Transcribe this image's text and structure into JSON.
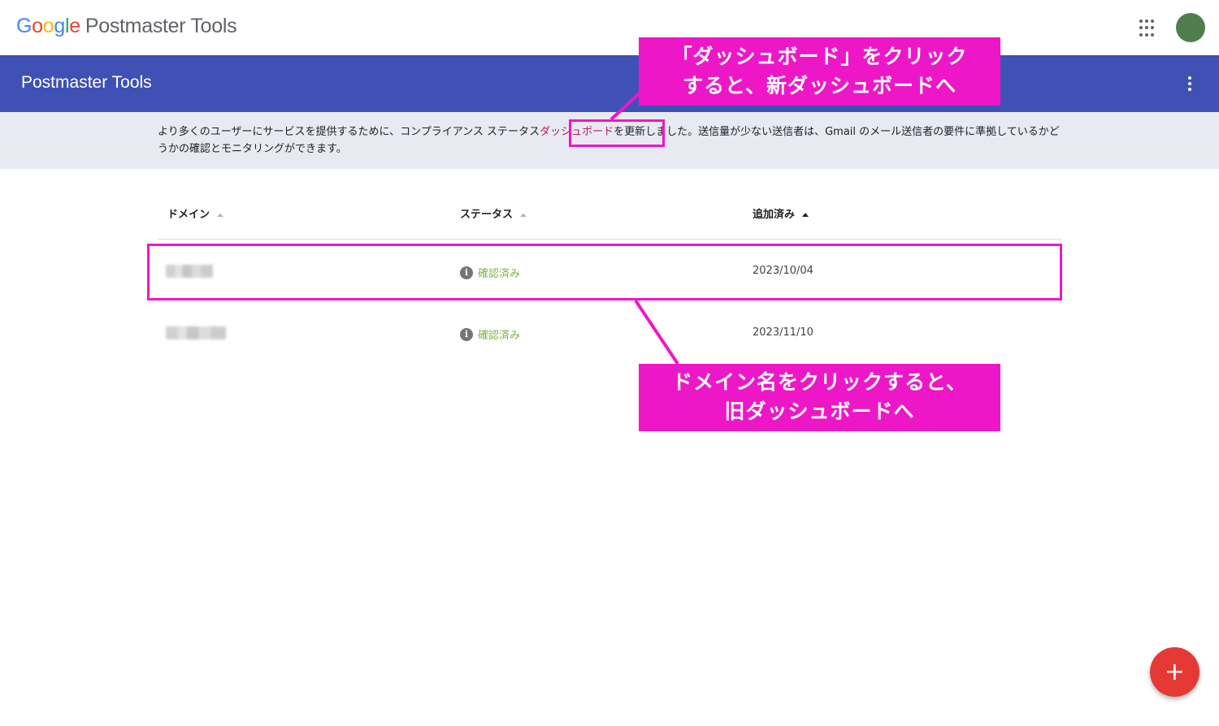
{
  "header": {
    "logo_letters": [
      "G",
      "o",
      "o",
      "g",
      "l",
      "e"
    ],
    "product": "Postmaster Tools",
    "apps_icon": "apps-grid-icon",
    "avatar_color": "#4e7d4e"
  },
  "appbar": {
    "title": "Postmaster Tools",
    "color": "#3f51b5",
    "menu_icon": "more-vert-icon"
  },
  "notice": {
    "before": "より多くのユーザーにサービスを提供するために、コンプライアンス ステータス",
    "link": "ダッシュボード",
    "after": "を更新しました。送信量が少ない送信者は、Gmail のメール送信者の要件に準拠しているかどうかの確認とモニタリングができます。"
  },
  "table": {
    "columns": [
      "ドメイン",
      "ステータス",
      "追加済み"
    ],
    "rows": [
      {
        "domain": "(blurred)",
        "status": "確認済み",
        "added": "2023/10/04"
      },
      {
        "domain": "(blurred)",
        "status": "確認済み",
        "added": "2023/11/10"
      }
    ]
  },
  "annotations": {
    "top": [
      "「ダッシュボード」をクリック",
      "すると、新ダッシュボードへ"
    ],
    "bottom": [
      "ドメイン名をクリックすると、",
      "旧ダッシュボードへ"
    ],
    "color": "#ee17c8"
  },
  "fab": {
    "label": "+",
    "color": "#e53935"
  }
}
